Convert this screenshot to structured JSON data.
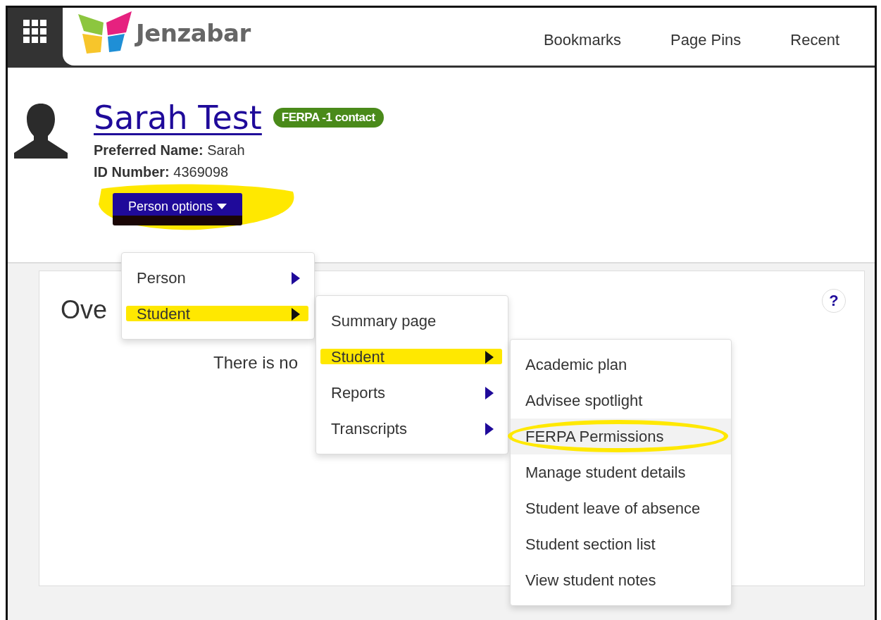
{
  "header": {
    "logo_text": "Jenzabar",
    "nav": [
      {
        "label": "Bookmarks"
      },
      {
        "label": "Page Pins"
      },
      {
        "label": "Recent"
      }
    ]
  },
  "person": {
    "name": "Sarah Test",
    "badge": "FERPA -1 contact",
    "fields": [
      {
        "label": "Preferred Name:",
        "value": "Sarah"
      },
      {
        "label": "ID Number:",
        "value": "4369098"
      }
    ]
  },
  "person_options": {
    "label": "Person options",
    "highlighted": true,
    "menu": [
      {
        "label": "Person",
        "kind": "submenu",
        "highlighted": false,
        "hovered": false,
        "circled": false
      },
      {
        "label": "Student",
        "kind": "submenu",
        "highlighted": true,
        "hovered": false,
        "circled": false,
        "children": [
          {
            "label": "Summary page",
            "kind": "action",
            "highlighted": false,
            "hovered": false,
            "circled": false
          },
          {
            "label": "Student",
            "kind": "submenu",
            "highlighted": true,
            "hovered": false,
            "circled": false,
            "children": [
              {
                "label": "Academic plan",
                "kind": "action",
                "highlighted": false,
                "hovered": false,
                "circled": false
              },
              {
                "label": "Advisee spotlight",
                "kind": "action",
                "highlighted": false,
                "hovered": false,
                "circled": false
              },
              {
                "label": "FERPA Permissions",
                "kind": "action",
                "highlighted": false,
                "hovered": true,
                "circled": true
              },
              {
                "label": "Manage student details",
                "kind": "action",
                "highlighted": false,
                "hovered": false,
                "circled": false
              },
              {
                "label": "Student leave of absence",
                "kind": "action",
                "highlighted": false,
                "hovered": false,
                "circled": false
              },
              {
                "label": "Student section list",
                "kind": "action",
                "highlighted": false,
                "hovered": false,
                "circled": false
              },
              {
                "label": "View student notes",
                "kind": "action",
                "highlighted": false,
                "hovered": false,
                "circled": false
              }
            ]
          },
          {
            "label": "Reports",
            "kind": "submenu",
            "highlighted": false,
            "hovered": false,
            "circled": false
          },
          {
            "label": "Transcripts",
            "kind": "submenu",
            "highlighted": false,
            "hovered": false,
            "circled": false
          }
        ]
      }
    ]
  },
  "card": {
    "title": "Ove",
    "help": "?",
    "message": "There is no"
  }
}
